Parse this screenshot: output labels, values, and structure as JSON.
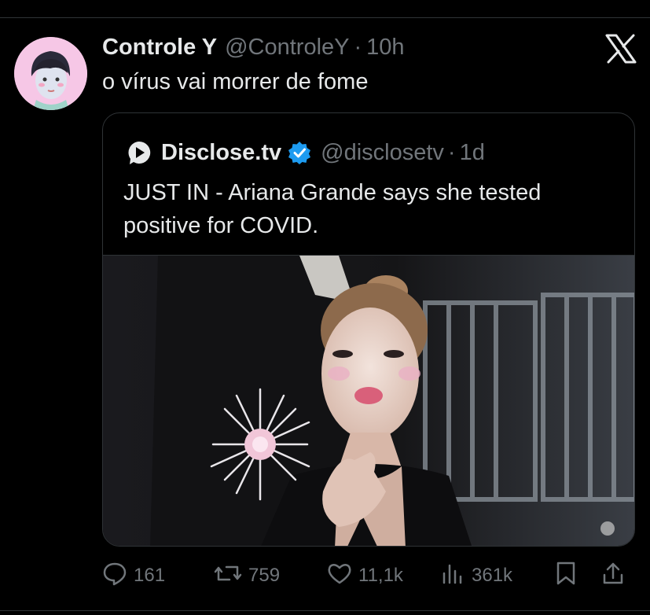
{
  "tweet": {
    "author_name": "Controle Y",
    "author_handle": "@ControleY",
    "separator": "·",
    "time": "10h",
    "text": "o vírus vai morrer de fome"
  },
  "quoted": {
    "author_name": "Disclose.tv",
    "author_handle": "@disclosetv",
    "separator": "·",
    "time": "1d",
    "text": "JUST IN - Ariana Grande says she tested positive for COVID."
  },
  "actions": {
    "replies": "161",
    "reposts": "759",
    "likes": "11,1k",
    "views": "361k"
  },
  "icons": {
    "platform": "x-logo-icon",
    "reply": "reply-icon",
    "repost": "repost-icon",
    "like": "heart-icon",
    "views": "views-chart-icon",
    "bookmark": "bookmark-icon",
    "share": "share-icon",
    "verified": "verified-badge-icon"
  },
  "colors": {
    "background": "#000000",
    "text": "#e7e9ea",
    "muted": "#71767b",
    "border": "#2f3336",
    "verified": "#1d9bf0"
  }
}
